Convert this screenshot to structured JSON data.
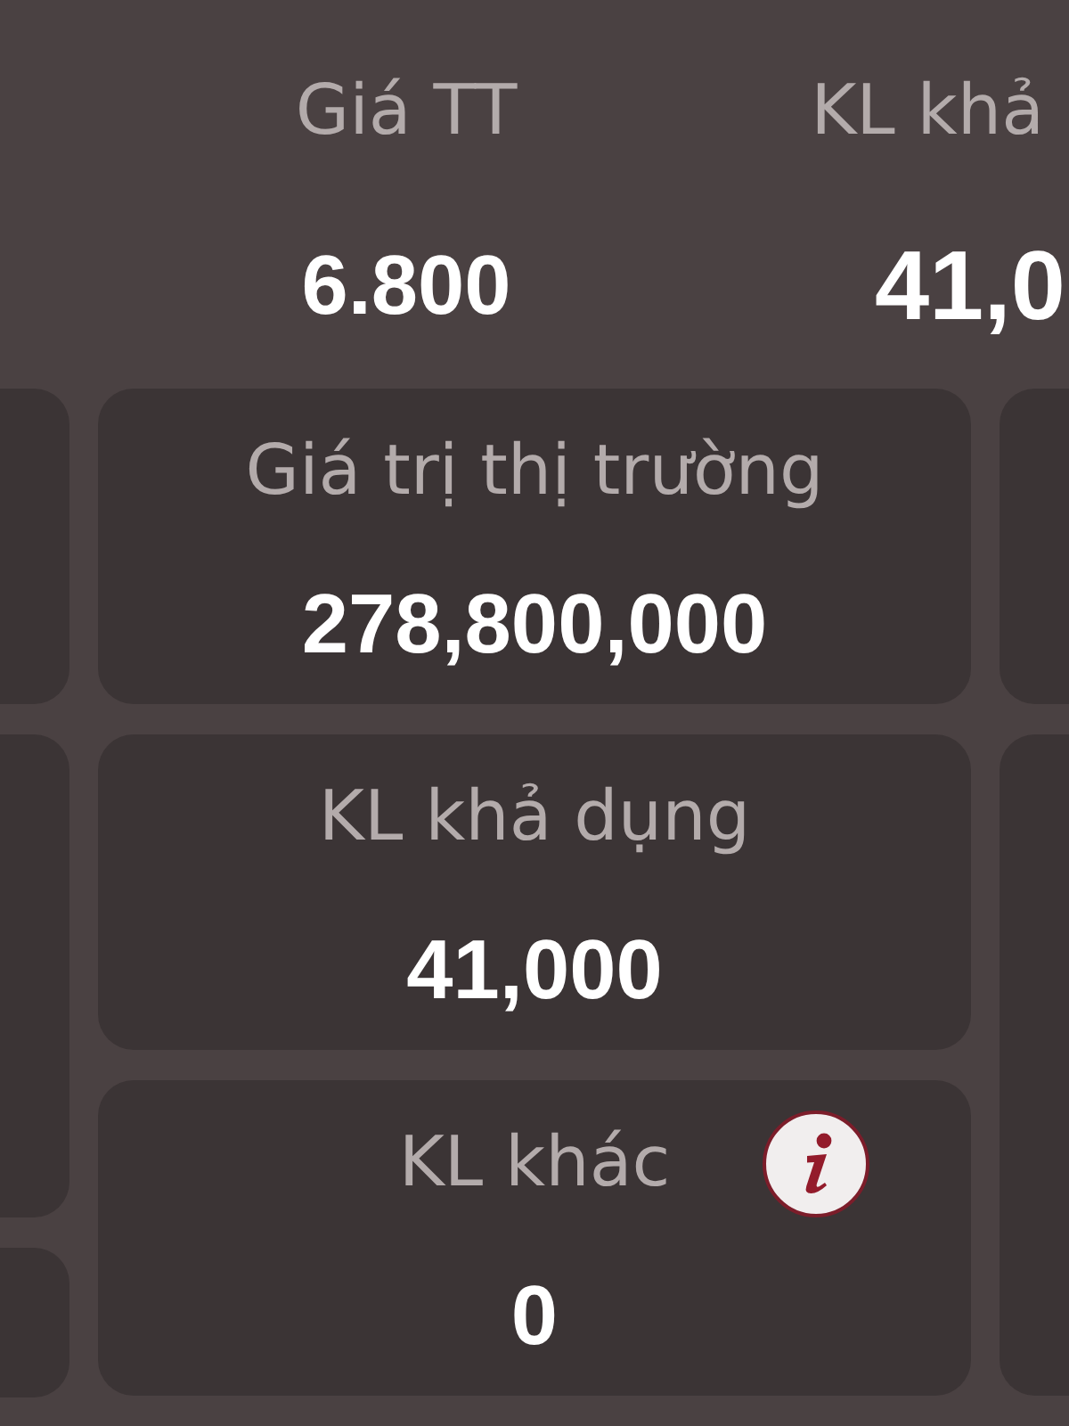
{
  "header": [
    {
      "label": "Giá TT",
      "value": "6.800",
      "kind": "normal"
    },
    {
      "label": "KL khả",
      "value": "41,0",
      "kind": "large"
    }
  ],
  "cards": [
    {
      "label": "Giá trị thị trường",
      "value": "278,800,000",
      "info": false
    },
    {
      "label": "KL khả dụng",
      "value": "41,000",
      "info": false
    },
    {
      "label": "KL khác",
      "value": "0",
      "info": true
    }
  ]
}
